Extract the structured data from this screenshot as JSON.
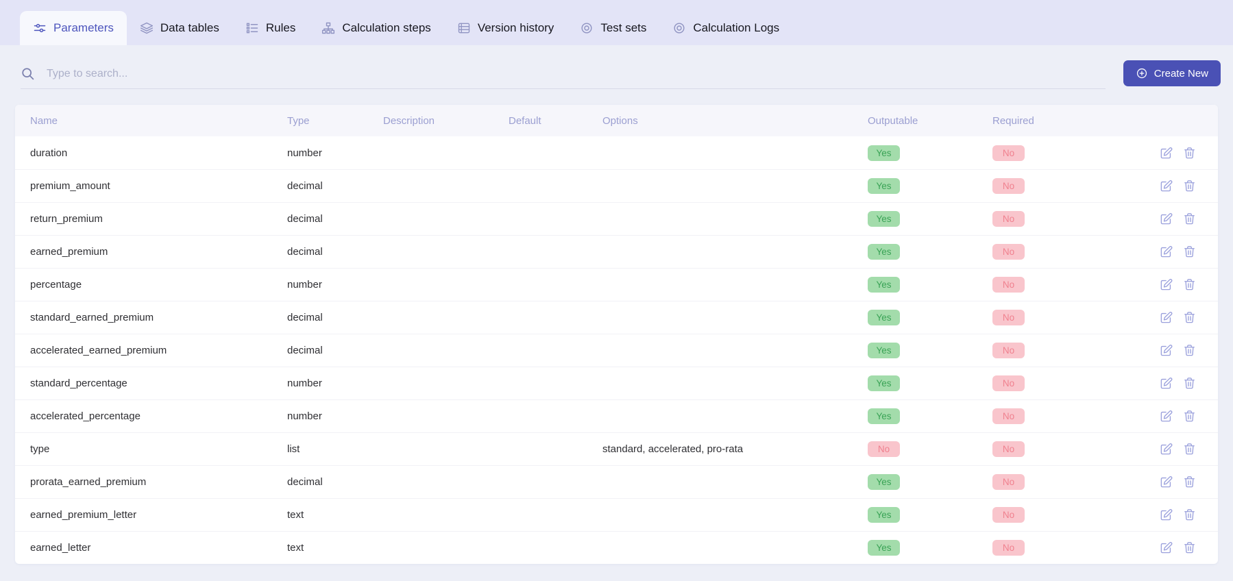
{
  "tabs": [
    {
      "label": "Parameters",
      "icon": "sliders-icon",
      "active": true
    },
    {
      "label": "Data tables",
      "icon": "layers-icon",
      "active": false
    },
    {
      "label": "Rules",
      "icon": "checklist-icon",
      "active": false
    },
    {
      "label": "Calculation steps",
      "icon": "sitemap-icon",
      "active": false
    },
    {
      "label": "Version history",
      "icon": "table-icon",
      "active": false
    },
    {
      "label": "Test sets",
      "icon": "target-icon",
      "active": false
    },
    {
      "label": "Calculation Logs",
      "icon": "target-icon",
      "active": false
    }
  ],
  "search": {
    "placeholder": "Type to search..."
  },
  "toolbar": {
    "create_button_label": "Create New"
  },
  "colors": {
    "accent": "#4a51b5",
    "tabbar_bg": "#e3e4f7",
    "page_bg": "#edeff7",
    "badge_yes_bg": "#a3dcab",
    "badge_yes_text": "#3aa356",
    "badge_no_bg": "#f9c5cc",
    "badge_no_text": "#f0818f"
  },
  "table": {
    "columns": [
      "Name",
      "Type",
      "Description",
      "Default",
      "Options",
      "Outputable",
      "Required"
    ],
    "rows": [
      {
        "name": "duration",
        "type": "number",
        "description": "",
        "default": "",
        "options": "",
        "outputable": "Yes",
        "required": "No"
      },
      {
        "name": "premium_amount",
        "type": "decimal",
        "description": "",
        "default": "",
        "options": "",
        "outputable": "Yes",
        "required": "No"
      },
      {
        "name": "return_premium",
        "type": "decimal",
        "description": "",
        "default": "",
        "options": "",
        "outputable": "Yes",
        "required": "No"
      },
      {
        "name": "earned_premium",
        "type": "decimal",
        "description": "",
        "default": "",
        "options": "",
        "outputable": "Yes",
        "required": "No"
      },
      {
        "name": "percentage",
        "type": "number",
        "description": "",
        "default": "",
        "options": "",
        "outputable": "Yes",
        "required": "No"
      },
      {
        "name": "standard_earned_premium",
        "type": "decimal",
        "description": "",
        "default": "",
        "options": "",
        "outputable": "Yes",
        "required": "No"
      },
      {
        "name": "accelerated_earned_premium",
        "type": "decimal",
        "description": "",
        "default": "",
        "options": "",
        "outputable": "Yes",
        "required": "No"
      },
      {
        "name": "standard_percentage",
        "type": "number",
        "description": "",
        "default": "",
        "options": "",
        "outputable": "Yes",
        "required": "No"
      },
      {
        "name": "accelerated_percentage",
        "type": "number",
        "description": "",
        "default": "",
        "options": "",
        "outputable": "Yes",
        "required": "No"
      },
      {
        "name": "type",
        "type": "list",
        "description": "",
        "default": "",
        "options": "standard, accelerated, pro-rata",
        "outputable": "No",
        "required": "No"
      },
      {
        "name": "prorata_earned_premium",
        "type": "decimal",
        "description": "",
        "default": "",
        "options": "",
        "outputable": "Yes",
        "required": "No"
      },
      {
        "name": "earned_premium_letter",
        "type": "text",
        "description": "",
        "default": "",
        "options": "",
        "outputable": "Yes",
        "required": "No"
      },
      {
        "name": "earned_letter",
        "type": "text",
        "description": "",
        "default": "",
        "options": "",
        "outputable": "Yes",
        "required": "No"
      }
    ]
  }
}
